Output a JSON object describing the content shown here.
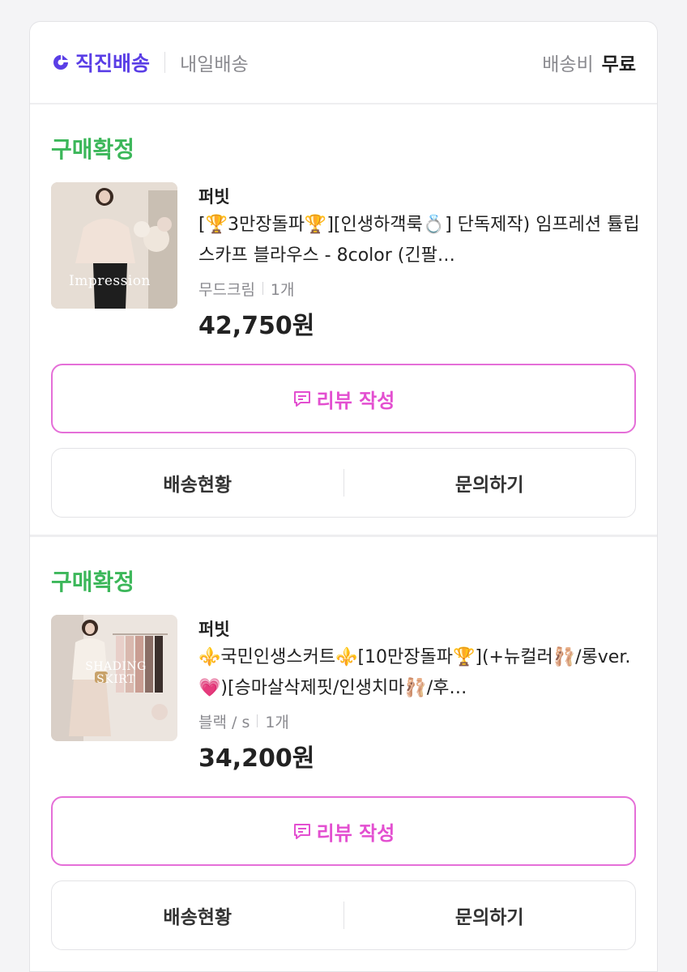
{
  "header": {
    "direct_label": "직진배송",
    "tomorrow_label": "내일배송",
    "fee_label": "배송비",
    "fee_value": "무료"
  },
  "orders": [
    {
      "status": "구매확정",
      "thumb_caption": "Impression",
      "brand": "퍼빗",
      "title": "[🏆3만장돌파🏆][인생하객룩💍] 단독제작) 임프레션 튤립 스카프 블라우스 - 8color (긴팔…",
      "option": "무드크림",
      "quantity": "1개",
      "price": "42,750원",
      "review_label": "리뷰 작성",
      "shipping_label": "배송현황",
      "inquiry_label": "문의하기"
    },
    {
      "status": "구매확정",
      "thumb_caption": "SHADING SKIRT",
      "brand": "퍼빗",
      "title": "⚜️국민인생스커트⚜️[10만장돌파🏆](+뉴컬러🩰/롱ver.💗)[승마살삭제핏/인생치마🩰/후…",
      "option": "블랙 / s",
      "quantity": "1개",
      "price": "34,200원",
      "review_label": "리뷰 작성",
      "shipping_label": "배송현황",
      "inquiry_label": "문의하기"
    }
  ],
  "colors": {
    "accent": "#5a3ee6",
    "status_green": "#3cb75a",
    "review_pink": "#e34fd0"
  }
}
